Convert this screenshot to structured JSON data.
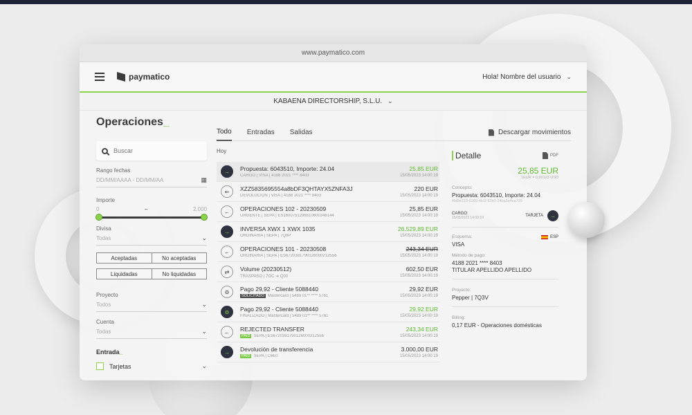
{
  "browser": {
    "url": "www.paymatico.com"
  },
  "app": {
    "logo_text": "paymatico",
    "greeting": "Hola! Nombre del usuario"
  },
  "company": {
    "name": "KABAENA DIRECTORSHIP, S.L.U."
  },
  "page": {
    "title": "Operaciones",
    "title_suffix": "_"
  },
  "filters": {
    "search_placeholder": "Buscar",
    "date_label": "Rango fechas",
    "date_placeholder": "DD/MM/AAAA - DD/MM/AA",
    "amount_label": "Importe",
    "amount_min": "0",
    "amount_sep": "–",
    "amount_max": "2.000",
    "currency_label": "Divisa",
    "currency_value": "Todas",
    "accepted_label": "Aceptadas",
    "not_accepted_label": "No aceptadas",
    "settled_label": "Liquidadas",
    "not_settled_label": "No liquidadas",
    "project_label": "Proyecto",
    "project_value": "Todos",
    "account_label": "Cuenta",
    "account_value": "Todas",
    "entry_title": "Entrada",
    "entry_suffix": "_",
    "cards_label": "Tarjetas"
  },
  "tabs": [
    {
      "label": "Todo"
    },
    {
      "label": "Entradas"
    },
    {
      "label": "Salidas"
    }
  ],
  "download_label": "Descargar movimientos",
  "day_label": "Hoy",
  "operations": [
    {
      "title": "Propuesta: 6043510, Importe: 24.04",
      "sub": "CARGO | VISA | 4188 2021 **** 8403",
      "badge": "",
      "amount": "25,85 EUR",
      "date": "15/05/2023 14:00:19",
      "icon": "→"
    },
    {
      "title": "XZZ5835695554a8bDF3QHTAYX5ZNFA3J",
      "sub": "DEVOLUCION | VISA | 4188 2021 **** 8403",
      "badge": "",
      "amount": "220 EUR",
      "date": "15/05/2023 14:00:19",
      "icon": "⇐"
    },
    {
      "title": "OPERACIONES 102 - 20230509",
      "sub": "URGENTE | SEPA | ES1600751296510600346144",
      "badge": "",
      "amount": "25,85 EUR",
      "date": "15/05/2023 14:00:19",
      "icon": "←"
    },
    {
      "title": "INVERSA XWX 1 XWX 1035",
      "sub": "ORDINARIA | SEPA | 7Q8P",
      "badge": "",
      "amount": "26.529,89 EUR",
      "date": "15/05/2023 14:00:19",
      "icon": "→"
    },
    {
      "title": "OPERACIONES 101 - 20230508",
      "sub": "ORDINARIA | SEPA | ES6720381790126000212556",
      "badge": "",
      "amount": "243,34 EUR",
      "date": "15/05/2023 14:00:19",
      "icon": "←"
    },
    {
      "title": "Volume (20230512)",
      "sub": "TRASPASO | 7OC ➔ Q00",
      "badge": "",
      "amount": "602,50 EUR",
      "date": "15/05/2023 14:00:19",
      "icon": "⇄"
    },
    {
      "title": "Pago 29,92 - Cliente 5088440",
      "sub": "Mastercard | 5489 01** **** 5761",
      "badge": "SOLICITADO",
      "amount": "29,92 EUR",
      "date": "15/05/2023 14:00:19",
      "icon": "⊜"
    },
    {
      "title": "Pago 29,92 - Cliente 5088440",
      "sub": "FINALIZADO | Mastercard | 5489 01** **** 5761",
      "badge": "",
      "amount": "29,92 EUR",
      "date": "15/05/2023 14:00:19",
      "icon": "⊜"
    },
    {
      "title": "REJECTED TRANSFER",
      "sub": "SEPA | ES6720381790126000212556",
      "badge": "PAID",
      "amount": "243,34 EUR",
      "date": "15/05/2023 14:00:19",
      "icon": "←"
    },
    {
      "title": "Devolución de transferencia",
      "sub": "SEPA | C6E0",
      "badge": "PAID",
      "amount": "3.000,00 EUR",
      "date": "15/05/2023 14:00:19",
      "icon": "→"
    }
  ],
  "detail": {
    "title": "Detalle",
    "pdf_label": "PDF",
    "amount": "25,85 EUR",
    "sub_amount": "1EUR = 0,90123 USD",
    "concept_label": "Concepto:",
    "concept_value": "Propuesta: 6043510, Importe: 24.04",
    "concept_id": "f4d9e319-0289-4b1f-92b0-24ba3e4ca799",
    "type_label": "CARGO",
    "type_date": "15/05/2023 14:00:19",
    "method_tag": "TARJETA",
    "country": "ESP",
    "scheme_label": "Esquema:",
    "scheme_value": "VISA",
    "pay_method_label": "Método de pago:",
    "pay_method_card": "4188 2021 **** 8403",
    "pay_method_holder": "TITULAR APELLIDO APELLIDO",
    "project_label": "Proyecto:",
    "project_value": "Pepper | 7Q3V",
    "billing_label": "Billing:",
    "billing_value": "0,17 EUR - Operaciones domésticas"
  },
  "colors": {
    "accent": "#8bd34a",
    "positive": "#5cb82c",
    "dark": "#1d2236"
  }
}
